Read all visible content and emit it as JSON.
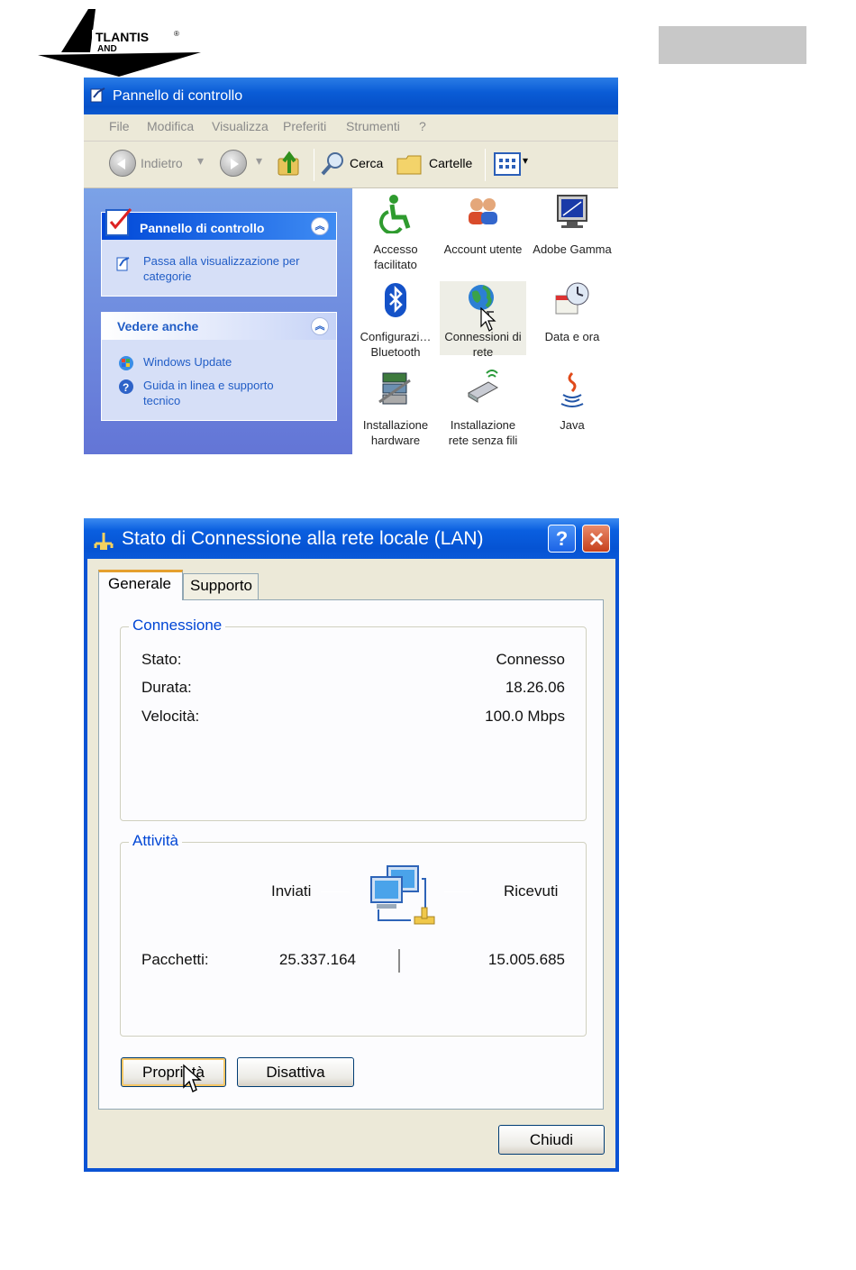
{
  "header": {
    "logo_text": "ATLANTIS LAND",
    "logo_mark": "®"
  },
  "control_panel": {
    "title": "Pannello di controllo",
    "menu": [
      "File",
      "Modifica",
      "Visualizza",
      "Preferiti",
      "Strumenti",
      "?"
    ],
    "toolbar": {
      "back": "Indietro",
      "search": "Cerca",
      "folders": "Cartelle"
    },
    "left_panel": {
      "panel1": {
        "title": "Pannello di controllo",
        "link": "Passa alla visualizzazione per categorie"
      },
      "panel2": {
        "title": "Vedere anche",
        "links": [
          "Windows Update",
          "Guida in linea e supporto tecnico"
        ]
      }
    },
    "items": [
      {
        "label": "Accesso facilitato",
        "icon": "accessibility-icon"
      },
      {
        "label": "Account utente",
        "icon": "users-icon"
      },
      {
        "label": "Adobe Gamma",
        "icon": "monitor-icon"
      },
      {
        "label": "Configurazi… Bluetooth",
        "icon": "bluetooth-icon"
      },
      {
        "label": "Connessioni di rete",
        "icon": "network-globe-icon",
        "selected": true
      },
      {
        "label": "Data e ora",
        "icon": "clock-icon"
      },
      {
        "label": "Installazione hardware",
        "icon": "hardware-icon"
      },
      {
        "label": "Installazione rete senza fili",
        "icon": "wireless-icon"
      },
      {
        "label": "Java",
        "icon": "java-icon"
      }
    ]
  },
  "dialog": {
    "title": "Stato di Connessione alla rete locale (LAN)",
    "help_label": "?",
    "tabs": [
      "Generale",
      "Supporto"
    ],
    "connection": {
      "legend": "Connessione",
      "status_label": "Stato:",
      "status_value": "Connesso",
      "duration_label": "Durata:",
      "duration_value": "18.26.06",
      "speed_label": "Velocità:",
      "speed_value": "100.0 Mbps"
    },
    "activity": {
      "legend": "Attività",
      "sent_label": "Inviati",
      "received_label": "Ricevuti",
      "packets_label": "Pacchetti:",
      "packets_sent": "25.337.164",
      "packets_received": "15.005.685"
    },
    "buttons": {
      "properties": "Proprietà",
      "disable": "Disattiva",
      "close": "Chiudi"
    }
  }
}
